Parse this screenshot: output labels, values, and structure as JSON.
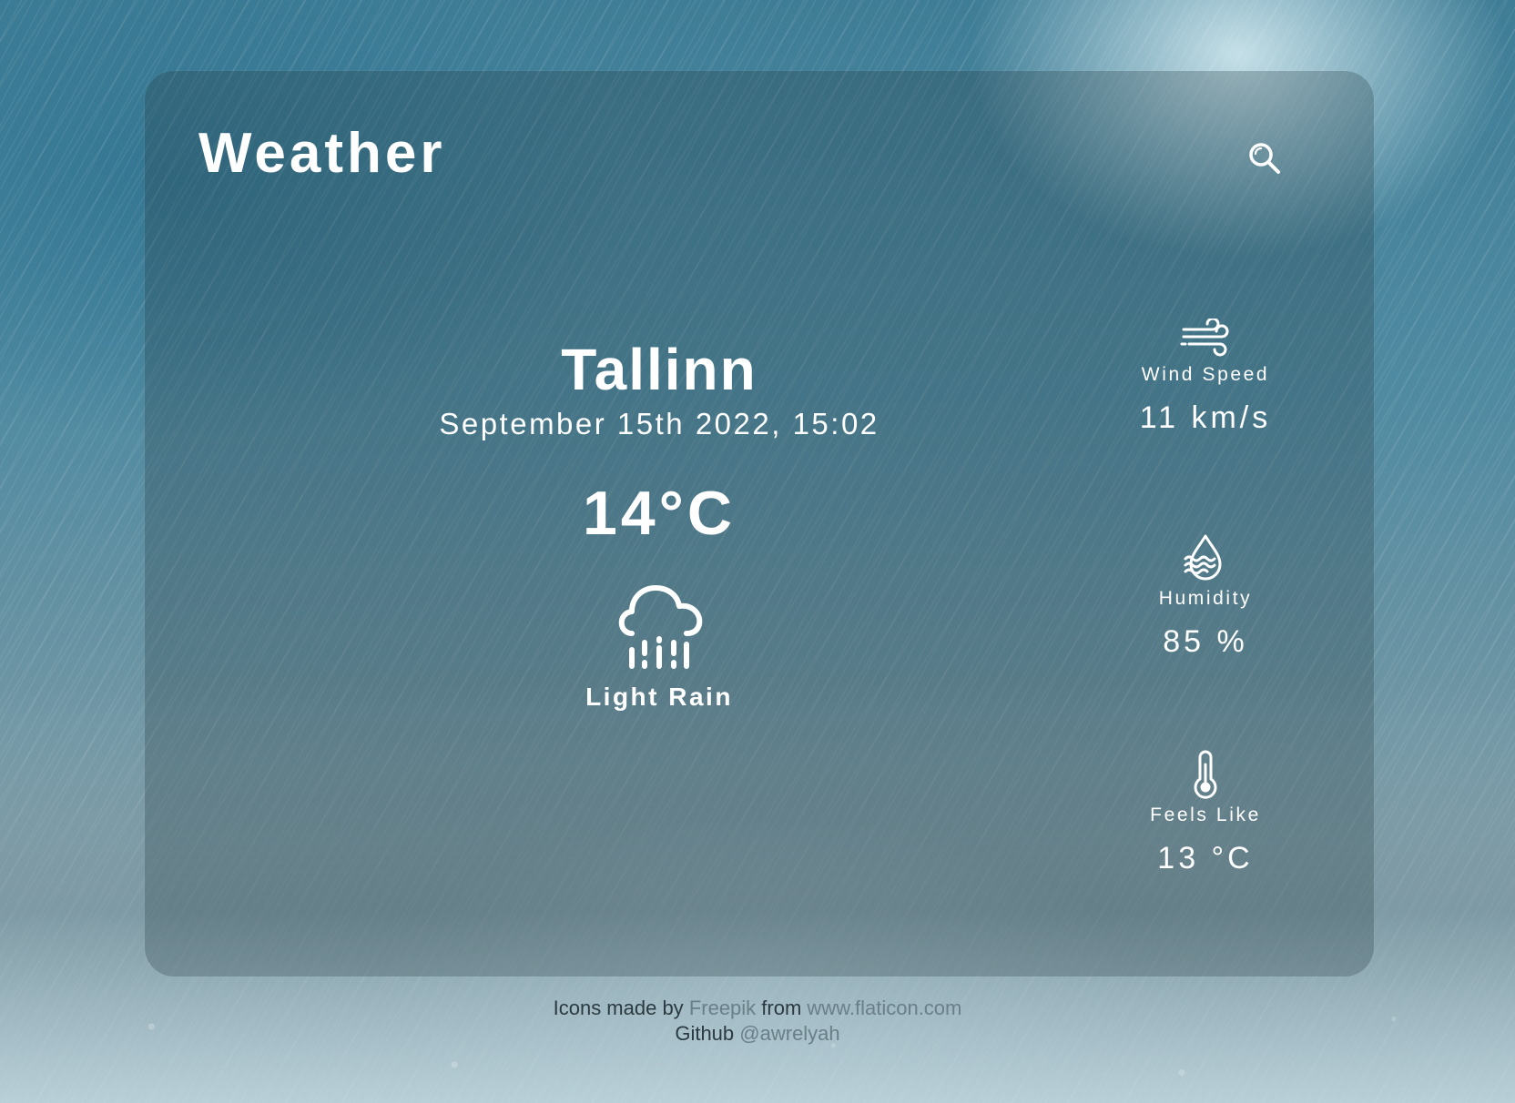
{
  "app": {
    "title": "Weather"
  },
  "search": {
    "icon": "search-icon"
  },
  "current": {
    "city": "Tallinn",
    "datetime": "September 15th 2022, 15:02",
    "temperature": "14°C",
    "condition": "Light Rain",
    "condition_icon": "rain-cloud-icon"
  },
  "stats": {
    "wind": {
      "icon": "wind-icon",
      "label": "Wind Speed",
      "value": "11 km/s"
    },
    "humidity": {
      "icon": "humidity-icon",
      "label": "Humidity",
      "value": "85 %"
    },
    "feels_like": {
      "icon": "thermometer-icon",
      "label": "Feels Like",
      "value": "13 °C"
    }
  },
  "footer": {
    "credit_prefix": "Icons made by",
    "credit_author": "Freepik",
    "credit_middle": "from",
    "credit_site": "www.flaticon.com",
    "github_prefix": "Github",
    "github_handle": "@awrelyah"
  },
  "colors": {
    "text": "#ffffff",
    "link": "#6a7f88",
    "footer_text": "#2b3a40"
  }
}
